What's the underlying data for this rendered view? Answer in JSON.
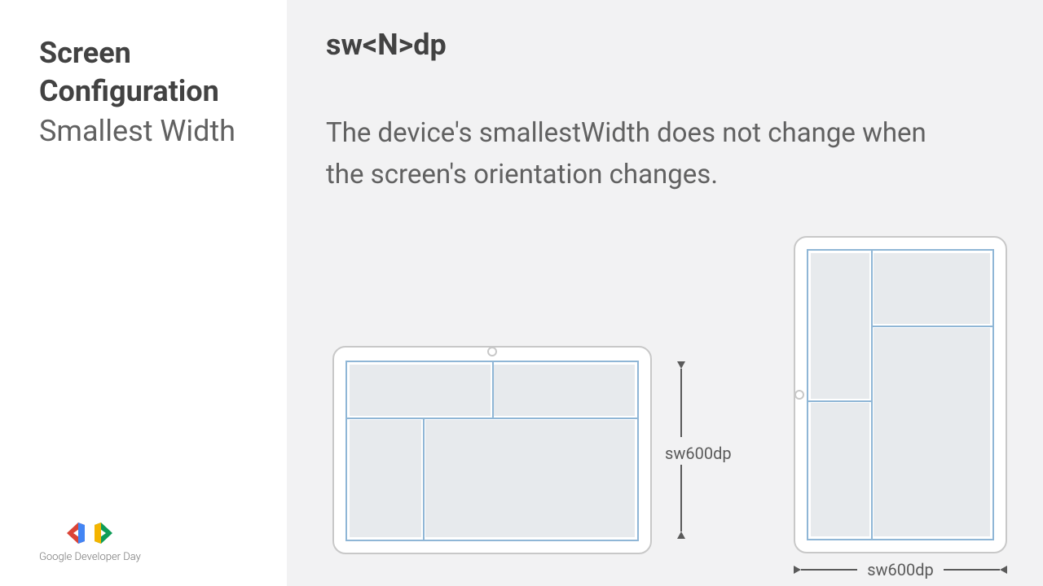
{
  "sidebar": {
    "title_line1": "Screen",
    "title_line2": "Configuration",
    "subtitle": "Smallest Width",
    "footer": "Google Developer Day"
  },
  "main": {
    "heading": "sw<N>dp",
    "body": "The device's smallestWidth does not change when the screen's orientation changes."
  },
  "diagram": {
    "landscape_label": "sw600dp",
    "portrait_label": "sw600dp"
  }
}
